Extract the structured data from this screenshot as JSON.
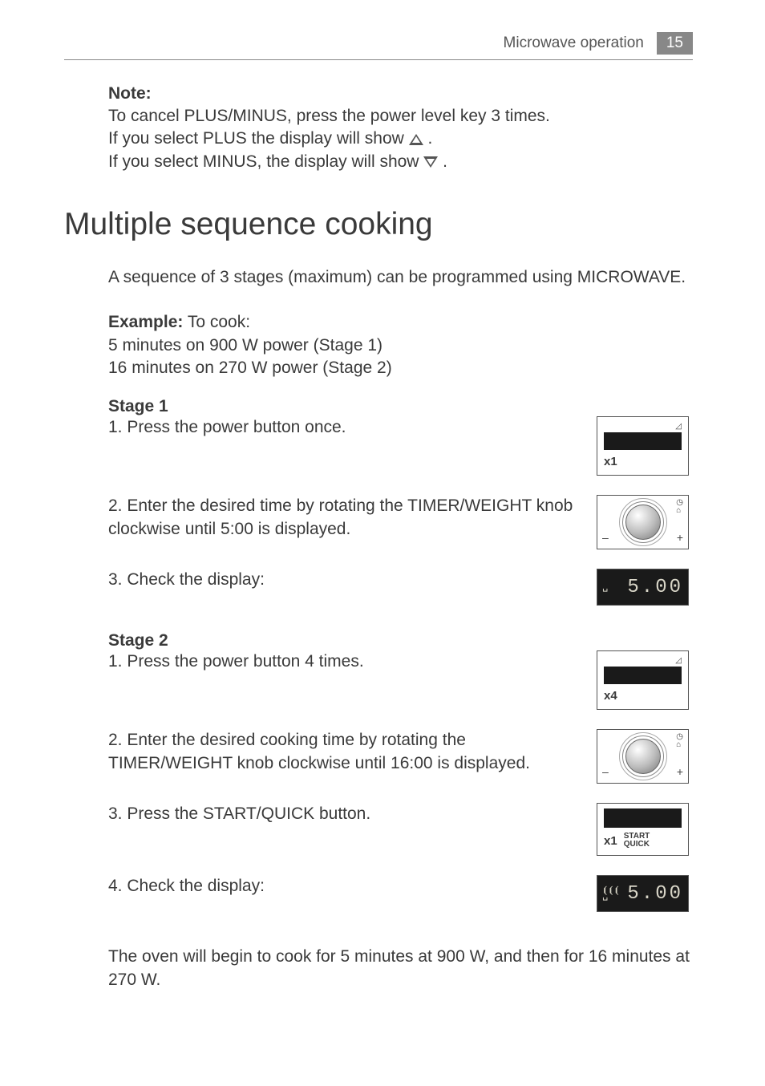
{
  "header": {
    "section": "Microwave operation",
    "page": "15"
  },
  "note": {
    "title": "Note:",
    "line1": "To cancel PLUS/MINUS, press the power level key 3 times.",
    "line2a": "If you select PLUS the display will show ",
    "line2b": " .",
    "line3a": "If you select MINUS, the display will show ",
    "line3b": "."
  },
  "heading": "Multiple sequence cooking",
  "intro": "A sequence of 3 stages (maximum) can be programmed using MICROWAVE.",
  "example": {
    "label": "Example:",
    "lead": " To cook:",
    "l1": "5 minutes on 900 W power   (Stage 1)",
    "l2": "16 minutes on 270 W power (Stage 2)"
  },
  "stage1": {
    "title": "Stage 1",
    "s1": "1. Press the power button once.",
    "s2": "2. Enter the desired time by rotating the TIMER/WEIGHT knob clockwise until 5:00 is displayed.",
    "s3": "3. Check the display:",
    "x": "x1",
    "time": "5.00"
  },
  "stage2": {
    "title": "Stage 2",
    "s1": "1. Press the power button 4 times.",
    "s2": "2. Enter the desired cooking time by rotating the TIMER/WEIGHT knob clockwise until 16:00 is displayed.",
    "s3": "3. Press the START/QUICK button.",
    "s4": "4. Check the display:",
    "x": "x4",
    "startx": "x1",
    "start1": "START",
    "start2": "QUICK",
    "time": "5.00"
  },
  "closing": "The oven will begin to cook for 5 minutes at 900 W, and then for 16 minutes at 270 W.",
  "knob": {
    "minus": "–",
    "plus": "+"
  }
}
